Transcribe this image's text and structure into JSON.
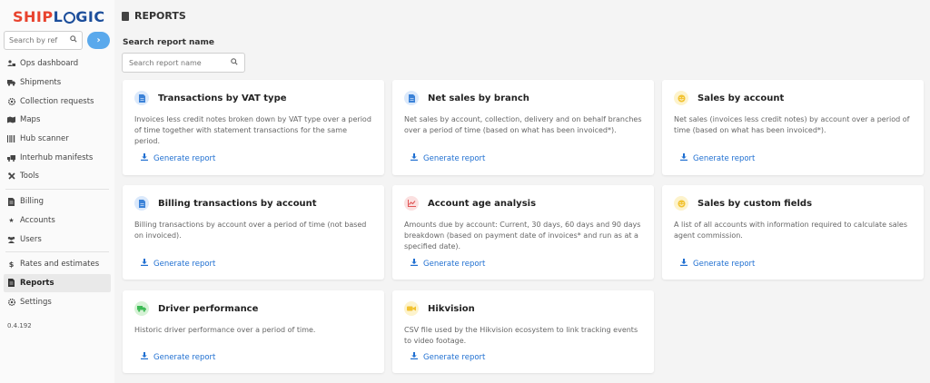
{
  "app": {
    "logo_left": "SHIP",
    "logo_l": "L",
    "logo_right": "GIC",
    "version": "0.4.192"
  },
  "colors": {
    "accent": "#1f6fd1",
    "logo_red": "#e8432e",
    "logo_blue": "#1c4e9b",
    "go_button": "#5aa9ec"
  },
  "sidebar": {
    "search_placeholder": "Search by ref",
    "go_icon": "chevron-right-icon",
    "groups": [
      [
        {
          "label": "Ops dashboard",
          "icon": "users-icon"
        },
        {
          "label": "Shipments",
          "icon": "truck-icon"
        },
        {
          "label": "Collection requests",
          "icon": "gear-icon"
        },
        {
          "label": "Maps",
          "icon": "map-icon"
        },
        {
          "label": "Hub scanner",
          "icon": "barcode-icon"
        },
        {
          "label": "Interhub manifests",
          "icon": "truck-loading-icon"
        },
        {
          "label": "Tools",
          "icon": "tools-icon"
        }
      ],
      [
        {
          "label": "Billing",
          "icon": "file-icon"
        },
        {
          "label": "Accounts",
          "icon": "star-icon"
        },
        {
          "label": "Users",
          "icon": "users-icon"
        }
      ],
      [
        {
          "label": "Rates and estimates",
          "icon": "dollar-icon"
        },
        {
          "label": "Reports",
          "icon": "file-icon",
          "active": true
        },
        {
          "label": "Settings",
          "icon": "gear-icon"
        }
      ]
    ]
  },
  "page": {
    "title": "REPORTS",
    "search_label": "Search report name",
    "search_placeholder": "Search report name"
  },
  "reports": [
    {
      "title": "Transactions by VAT type",
      "icon": "file-icon",
      "desc": "Invoices less credit notes broken down by VAT type over a period of time together with statement transactions for the same period.",
      "link": "Generate report"
    },
    {
      "title": "Net sales by branch",
      "icon": "file-icon",
      "desc": "Net sales by account, collection, delivery and on behalf branches over a period of time (based on what has been invoiced*).",
      "link": "Generate report"
    },
    {
      "title": "Sales by account",
      "icon": "smile-icon",
      "desc": "Net sales (invoices less credit notes) by account over a period of time (based on what has been invoiced*).",
      "link": "Generate report"
    },
    {
      "title": "Billing transactions by account",
      "icon": "file-icon",
      "desc": "Billing transactions by account over a period of time (not based on invoiced).",
      "link": "Generate report"
    },
    {
      "title": "Account age analysis",
      "icon": "chart-icon",
      "desc": "Amounts due by account: Current, 30 days, 60 days and 90 days breakdown (based on payment date of invoices* and run as at a specified date).",
      "link": "Generate report"
    },
    {
      "title": "Sales by custom fields",
      "icon": "smile-icon",
      "desc": "A list of all accounts with information required to calculate sales agent commission.",
      "link": "Generate report"
    },
    {
      "title": "Driver performance",
      "icon": "truck-icon",
      "desc": "Historic driver performance over a period of time.",
      "link": "Generate report"
    },
    {
      "title": "Hikvision",
      "icon": "video-camera-icon",
      "desc": "CSV file used by the Hikvision ecosystem to link tracking events to video footage.",
      "link": "Generate report"
    }
  ]
}
